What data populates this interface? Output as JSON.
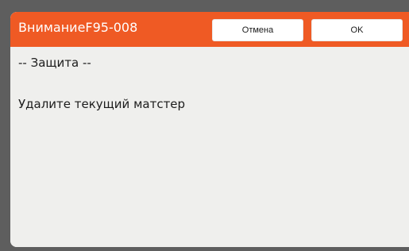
{
  "dialog": {
    "title": "ВниманиеF95-008",
    "cancel_label": "Отмена",
    "ok_label": "OK",
    "lines": [
      "-- Защита --",
      "Удалите текущий матстер"
    ]
  },
  "colors": {
    "header": "#ef5a24",
    "body": "#efefed",
    "frame": "#5e5e5e"
  }
}
